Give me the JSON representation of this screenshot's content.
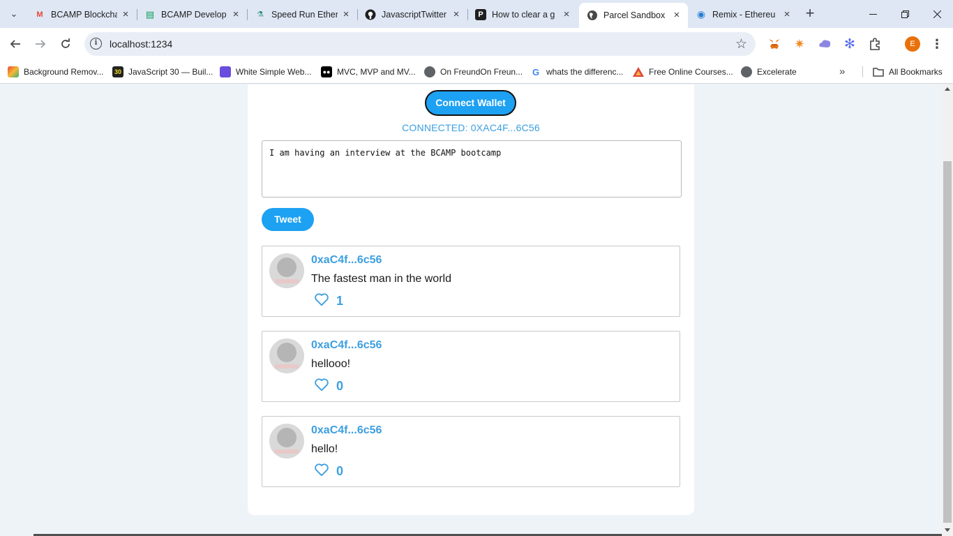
{
  "browser": {
    "tabs": [
      {
        "title": "BCAMP Blockcha",
        "icon": "gmail-icon",
        "color": "#ea4335",
        "glyph": "M",
        "active": false
      },
      {
        "title": "BCAMP Develop",
        "icon": "sheets-icon",
        "color": "#0f9d58",
        "glyph": "▤",
        "active": false
      },
      {
        "title": "Speed Run Ether",
        "icon": "speedrun-icon",
        "color": "#2a8c7a",
        "glyph": "⚗",
        "active": false
      },
      {
        "title": "JavascriptTwitter",
        "icon": "github-icon",
        "color": "#1f1f1f",
        "glyph": "●",
        "active": false
      },
      {
        "title": "How to clear a g",
        "icon": "p-logo-icon",
        "color": "#1f1f1f",
        "glyph": "P",
        "active": false
      },
      {
        "title": "Parcel Sandbox",
        "icon": "globe-icon",
        "color": "#474747",
        "glyph": "◍",
        "active": true
      },
      {
        "title": "Remix - Ethereu",
        "icon": "remix-icon",
        "color": "#2a7fd4",
        "glyph": "◉",
        "active": false
      }
    ],
    "url": "localhost:1234",
    "profile_initial": "E",
    "bookmarks": [
      {
        "label": "Background Remov...",
        "icon": "removebg-icon",
        "color": "#e64a3b"
      },
      {
        "label": "JavaScript 30 — Buil...",
        "icon": "js30-icon",
        "color": "#222222"
      },
      {
        "label": "White Simple Web...",
        "icon": "canva-icon",
        "color": "#6a4cde"
      },
      {
        "label": "MVC, MVP and MV...",
        "icon": "medium-icon",
        "color": "#000000"
      },
      {
        "label": "On FreundOn Freun...",
        "icon": "globe-icon",
        "color": "#5f6368"
      },
      {
        "label": "whats the differenc...",
        "icon": "google-icon",
        "color": "#4285f4"
      },
      {
        "label": "Free Online Courses...",
        "icon": "alison-icon",
        "color": "#e0413b"
      },
      {
        "label": "Excelerate",
        "icon": "globe-icon",
        "color": "#5f6368"
      }
    ],
    "all_bookmarks": "All Bookmarks"
  },
  "app": {
    "connect_button": "Connect Wallet",
    "connected_status": "CONNECTED: 0XAC4F...6C56",
    "tweet_input_value": "I am having an interview at the BCAMP bootcamp",
    "tweet_button": "Tweet",
    "posts": [
      {
        "author": "0xaC4f...6c56",
        "message": "The fastest man in the world",
        "likes": "1"
      },
      {
        "author": "0xaC4f...6c56",
        "message": "hellooo!",
        "likes": "0"
      },
      {
        "author": "0xaC4f...6c56",
        "message": "hello!",
        "likes": "0"
      }
    ],
    "accent_color": "#1da1f2"
  }
}
